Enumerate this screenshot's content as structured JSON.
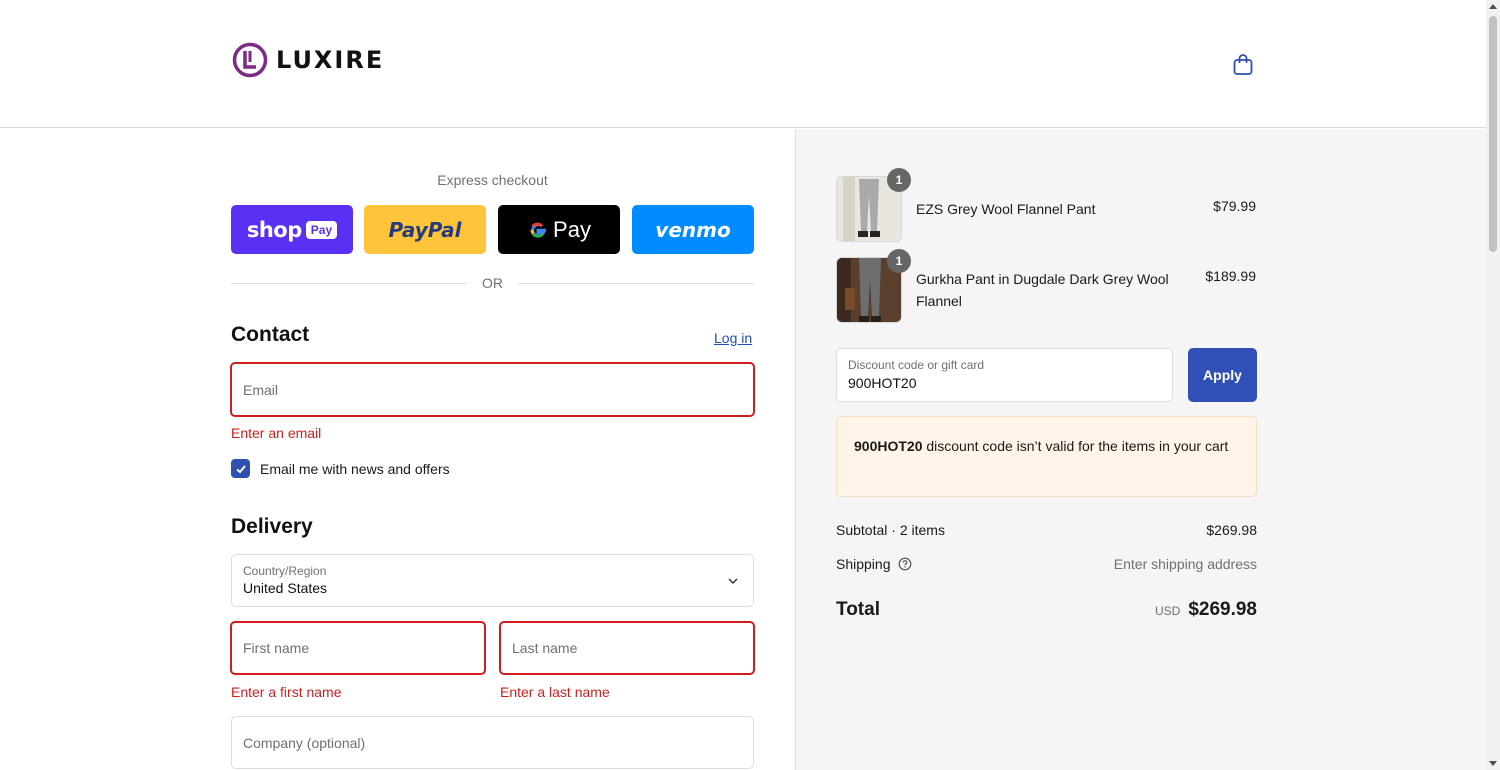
{
  "brand": {
    "name": "LUXIRE",
    "color": "#7b2a86"
  },
  "header": {
    "cart_icon": "shopping-bag-icon"
  },
  "express": {
    "label": "Express checkout",
    "buttons": [
      {
        "name": "shop",
        "tag": "Pay",
        "color": "#5a31f4"
      },
      {
        "name": "PayPal",
        "color": "#ffc439"
      },
      {
        "name": "Pay",
        "color": "#000000"
      },
      {
        "name": "venmo",
        "color": "#008cff"
      }
    ],
    "or": "OR"
  },
  "contact": {
    "title": "Contact",
    "login": "Log in",
    "email_placeholder": "Email",
    "email_error": "Enter an email",
    "newsletter_label": "Email me with news and offers",
    "newsletter_checked": true
  },
  "delivery": {
    "title": "Delivery",
    "country_label": "Country/Region",
    "country_value": "United States",
    "first_name_placeholder": "First name",
    "first_name_error": "Enter a first name",
    "last_name_placeholder": "Last name",
    "last_name_error": "Enter a last name",
    "company_placeholder": "Company (optional)"
  },
  "cart": {
    "items": [
      {
        "name": "EZS Grey Wool Flannel Pant",
        "price": "$79.99",
        "qty": "1"
      },
      {
        "name": "Gurkha Pant in Dugdale Dark Grey Wool Flannel",
        "price": "$189.99",
        "qty": "1"
      }
    ],
    "discount_label": "Discount code or gift card",
    "discount_value": "900HOT20",
    "apply": "Apply",
    "notice_code": "900HOT20",
    "notice_text": " discount code isn’t valid for the items in your cart",
    "subtotal_label": "Subtotal · 2 items",
    "subtotal_value": "$269.98",
    "shipping_label": "Shipping",
    "shipping_value": "Enter shipping address",
    "total_label": "Total",
    "currency": "USD",
    "total_value": "$269.98"
  },
  "colors": {
    "error": "#d01e1e",
    "accent": "#3050b8",
    "link": "#1f4fb8"
  }
}
